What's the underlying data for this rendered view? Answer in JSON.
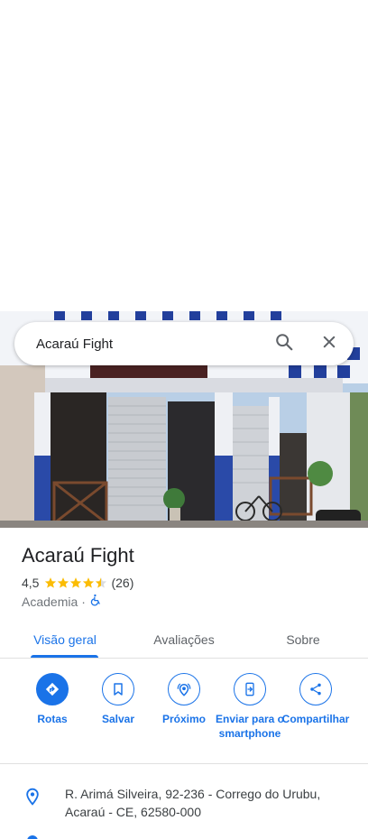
{
  "search": {
    "value": "Acaraú Fight"
  },
  "place": {
    "title": "Acaraú Fight",
    "rating": "4,5",
    "rating_value": 4.5,
    "rating_max": 5,
    "reviews_count": "(26)",
    "category": "Academia",
    "separator": "·",
    "accessible_icon": "wheelchair-icon"
  },
  "tabs": [
    {
      "label": "Visão geral",
      "active": true
    },
    {
      "label": "Avaliações",
      "active": false
    },
    {
      "label": "Sobre",
      "active": false
    }
  ],
  "actions": [
    {
      "label": "Rotas",
      "icon": "directions-icon"
    },
    {
      "label": "Salvar",
      "icon": "bookmark-icon"
    },
    {
      "label": "Próximo",
      "icon": "nearby-icon"
    },
    {
      "label": "Enviar para o smartphone",
      "icon": "send-to-phone-icon"
    },
    {
      "label": "Compartilhar",
      "icon": "share-icon"
    }
  ],
  "address": {
    "line1": "R. Arimá Silveira, 92-236 - Corrego do Urubu,",
    "line2": "Acaraú - CE, 62580-000",
    "icon": "location-pin-icon"
  },
  "colors": {
    "accent": "#1a73e8",
    "star": "#fbbc04"
  }
}
